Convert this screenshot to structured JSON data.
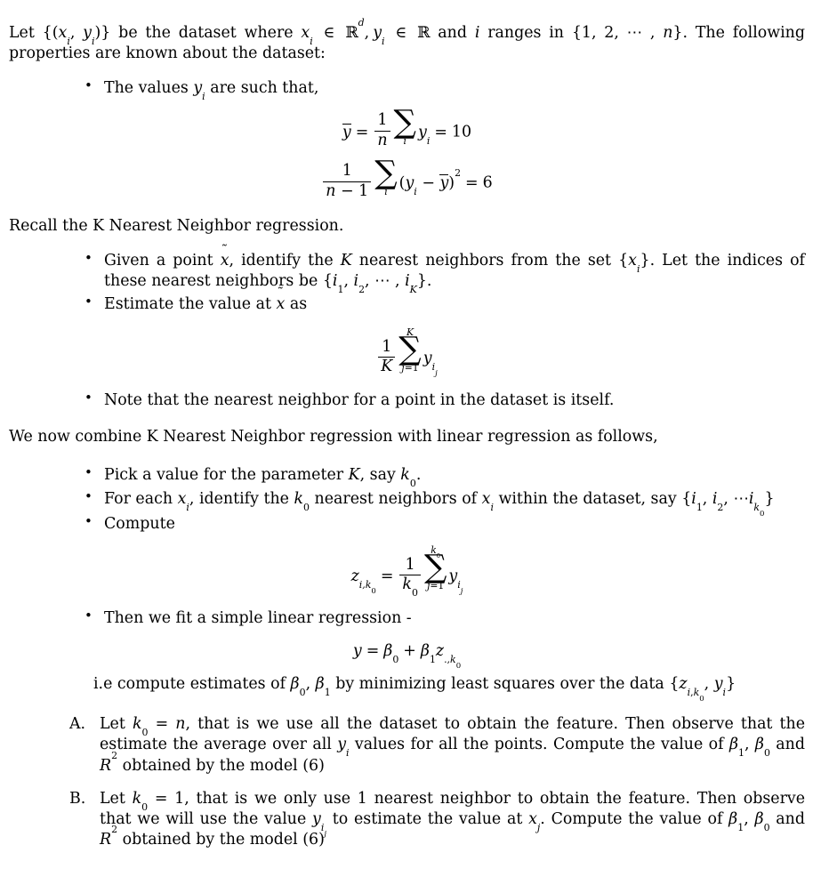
{
  "document": {
    "intro": {
      "text_before_set": "Let ",
      "set": "{(x_i, y_i)}",
      "text_mid1": " be the dataset where ",
      "cond1": "x_i ∈ ℝ^d",
      "text_mid2": ", ",
      "cond2": "y_i ∈ ℝ",
      "text_mid3": " and ",
      "index_var": "i",
      "text_mid4": " ranges in ",
      "range_set": "{1, 2, ⋯ , n}",
      "text_end": ". The following properties are known about the dataset:"
    },
    "bullet_values": {
      "text_before": "The values ",
      "var": "y_i",
      "text_after": " are such that,"
    },
    "equation_mean": {
      "lhs": "ȳ",
      "equals": "=",
      "frac_num": "1",
      "frac_den": "n",
      "sum_sub": "i",
      "summand": "y_i",
      "equals2": "=",
      "value": "10"
    },
    "equation_variance": {
      "frac_num": "1",
      "frac_den": "n − 1",
      "sum_sub": "i",
      "summand": "(y_i − ȳ)²",
      "equals": "=",
      "value": "6"
    },
    "recall_line": "Recall the K Nearest Neighbor regression.",
    "bullet_given": {
      "p1": "Given a point ",
      "xtilde": "x̃",
      "p2": ", identify the ",
      "K": "K",
      "p3": " nearest neighbors from the set ",
      "set_x": "{x_i}",
      "p4": ". Let the indices of these nearest neighbors be ",
      "set_i": "{i₁, i₂, ⋯ , i_K}",
      "p5": "."
    },
    "bullet_estimate": {
      "p1": "Estimate the value at ",
      "xtilde": "x̃",
      "p2": " as"
    },
    "equation_knn": {
      "frac_num": "1",
      "frac_den": "K",
      "sum_top": "K",
      "sum_bottom": "j=1",
      "summand": "y_{i_j}"
    },
    "bullet_note": "Note that the nearest neighbor for a point in the dataset is itself.",
    "combine_line": "We now combine K Nearest Neighbor regression with linear regression as follows,",
    "bullet_pick": {
      "p1": "Pick a value for the parameter ",
      "K": "K",
      "p2": ", say ",
      "k0": "k₀",
      "p3": "."
    },
    "bullet_foreach": {
      "p1": "For each ",
      "xi": "x_i",
      "p2": ", identify the ",
      "k0": "k₀",
      "p3": " nearest neighbors of ",
      "xi2": "x_i",
      "p4": " within the dataset, say ",
      "set": "{i₁, i₂, ⋯ i_{k₀}}"
    },
    "bullet_compute": "Compute",
    "equation_z": {
      "lhs": "z_{i,k₀}",
      "equals": "=",
      "frac_num": "1",
      "frac_den": "k₀",
      "sum_top": "k₀",
      "sum_bottom": "j=1",
      "summand": "y_{i_j}"
    },
    "bullet_fit": "Then we fit a simple linear regression -",
    "equation_linreg": {
      "lhs": "y",
      "equals": "=",
      "beta0": "β₀",
      "plus": "+",
      "beta1": "β₁",
      "z": "z_{.,k₀}"
    },
    "ie_line": {
      "p1": "i.e compute estimates of ",
      "betas": "β₀, β₁",
      "p2": " by minimizing least squares over the data ",
      "data_set": "{z_{i,k₀}, y_i}"
    },
    "items": [
      {
        "marker": "A.",
        "p1": "Let ",
        "eq": "k₀ = n",
        "p2": ", that is we use all the dataset to obtain the feature. Then observe that the estimate the average over all ",
        "var": "y_i",
        "p3": " values for all the points. Compute the value of ",
        "betas": "β₁, β₀",
        "p4": " and ",
        "R2": "R²",
        "p5": " obtained by the model (6)"
      },
      {
        "marker": "B.",
        "p1": "Let ",
        "eq": "k₀ = 1",
        "p2": ", that is we only use 1 nearest neighbor to obtain the feature. Then observe that we will use the value ",
        "var": "y_{i_j}",
        "p3": " to estimate the value at ",
        "var2": "x_j",
        "p4": ". Compute the value of ",
        "betas": "β₁, β₀",
        "p5": " and ",
        "R2": "R²",
        "p6": " obtained by the model (6)"
      }
    ]
  },
  "colors": {
    "background": "#ffffff",
    "text": "#000000"
  }
}
